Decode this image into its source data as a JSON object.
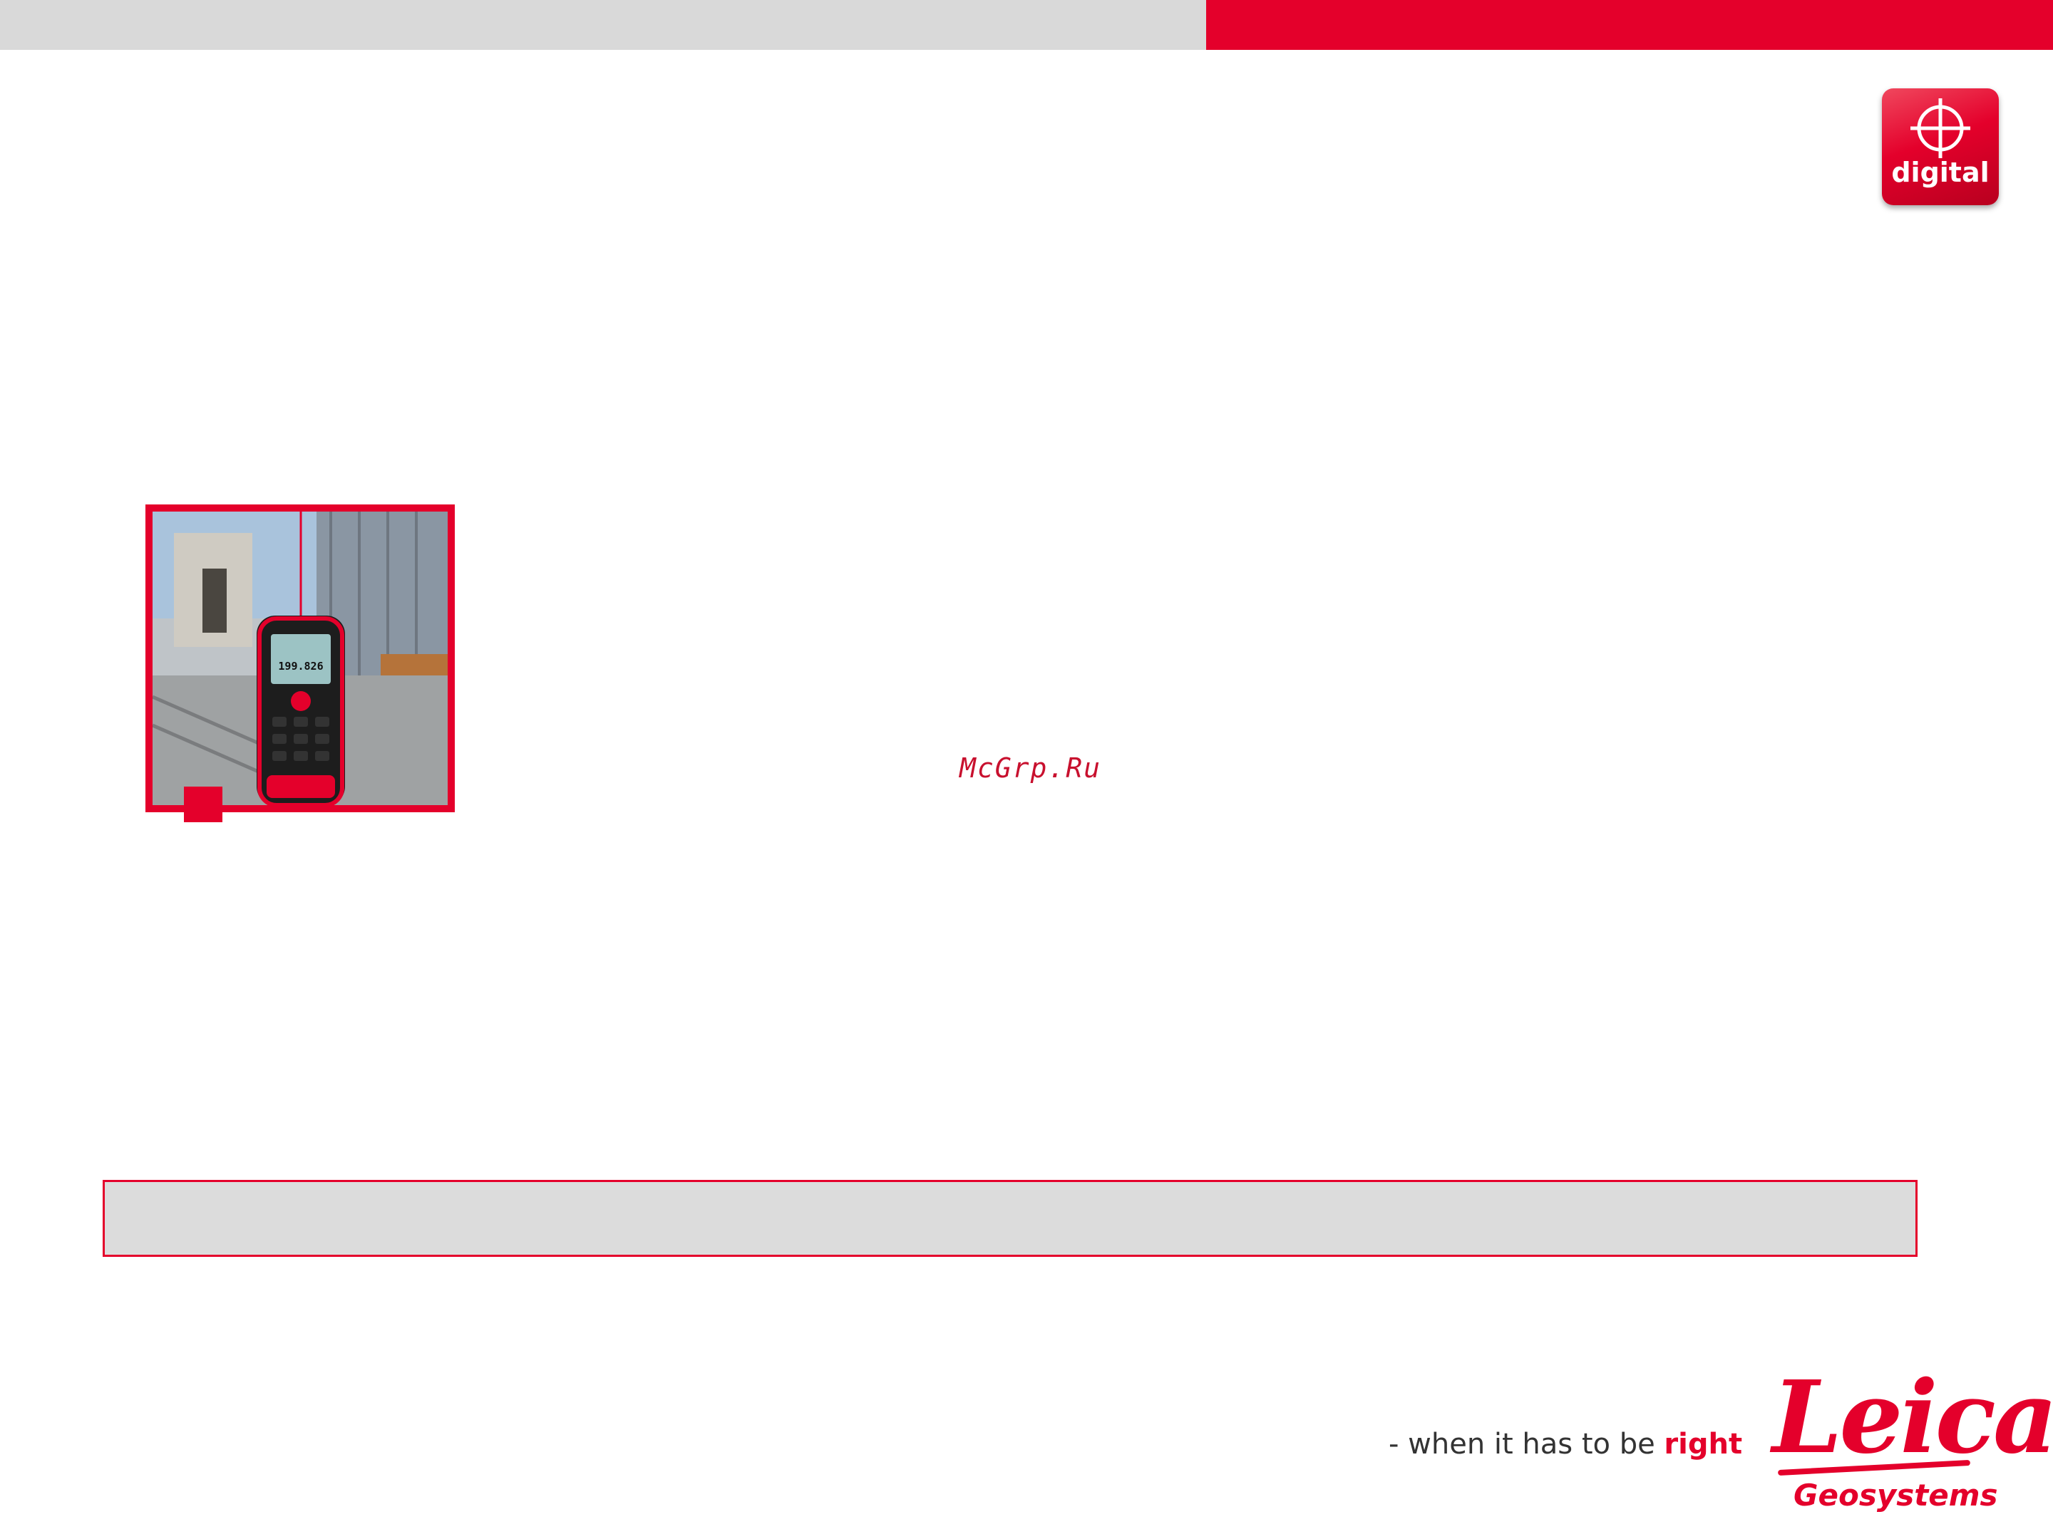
{
  "header": {
    "bar_colors": {
      "left": "#d9d9d9",
      "right": "#e4002b"
    }
  },
  "badge": {
    "icon": "crosshair-icon",
    "label": "digital"
  },
  "photo": {
    "device_reading": "199.826"
  },
  "watermark": "McGrp.Ru",
  "footer": {
    "tagline_prefix": "- when it has to be ",
    "tagline_emphasis": "right",
    "logo_word": "Leica",
    "logo_sub": "Geosystems"
  },
  "colors": {
    "brand_red": "#e4002b",
    "box_gray": "#dcdcdc"
  }
}
